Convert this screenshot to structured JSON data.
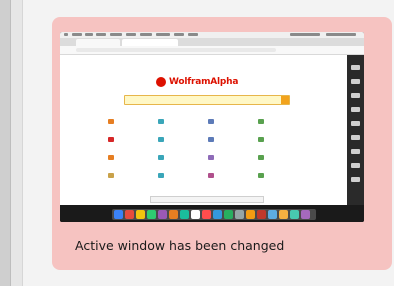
{
  "card": {
    "caption": "Active window has been changed",
    "background": "#f6c3c1"
  },
  "screenshot": {
    "logo": {
      "wordmark": "WolframAlpha",
      "brand_color": "#dd1100",
      "icon": "wolfram-logo-icon"
    },
    "search_bar_color": "#fff8c6",
    "search_button_color": "#f2a31c",
    "dock_icon_colors": [
      "#3b82f6",
      "#e74c3c",
      "#f1c40f",
      "#2ecc71",
      "#9b59b6",
      "#e67e22",
      "#1abc9c",
      "#ffffff",
      "#ff4d4d",
      "#3498db",
      "#27ae60",
      "#95a5a6",
      "#f39c12",
      "#c0392b",
      "#5dade2",
      "#f5b041",
      "#48c9b0",
      "#a569bd"
    ]
  }
}
